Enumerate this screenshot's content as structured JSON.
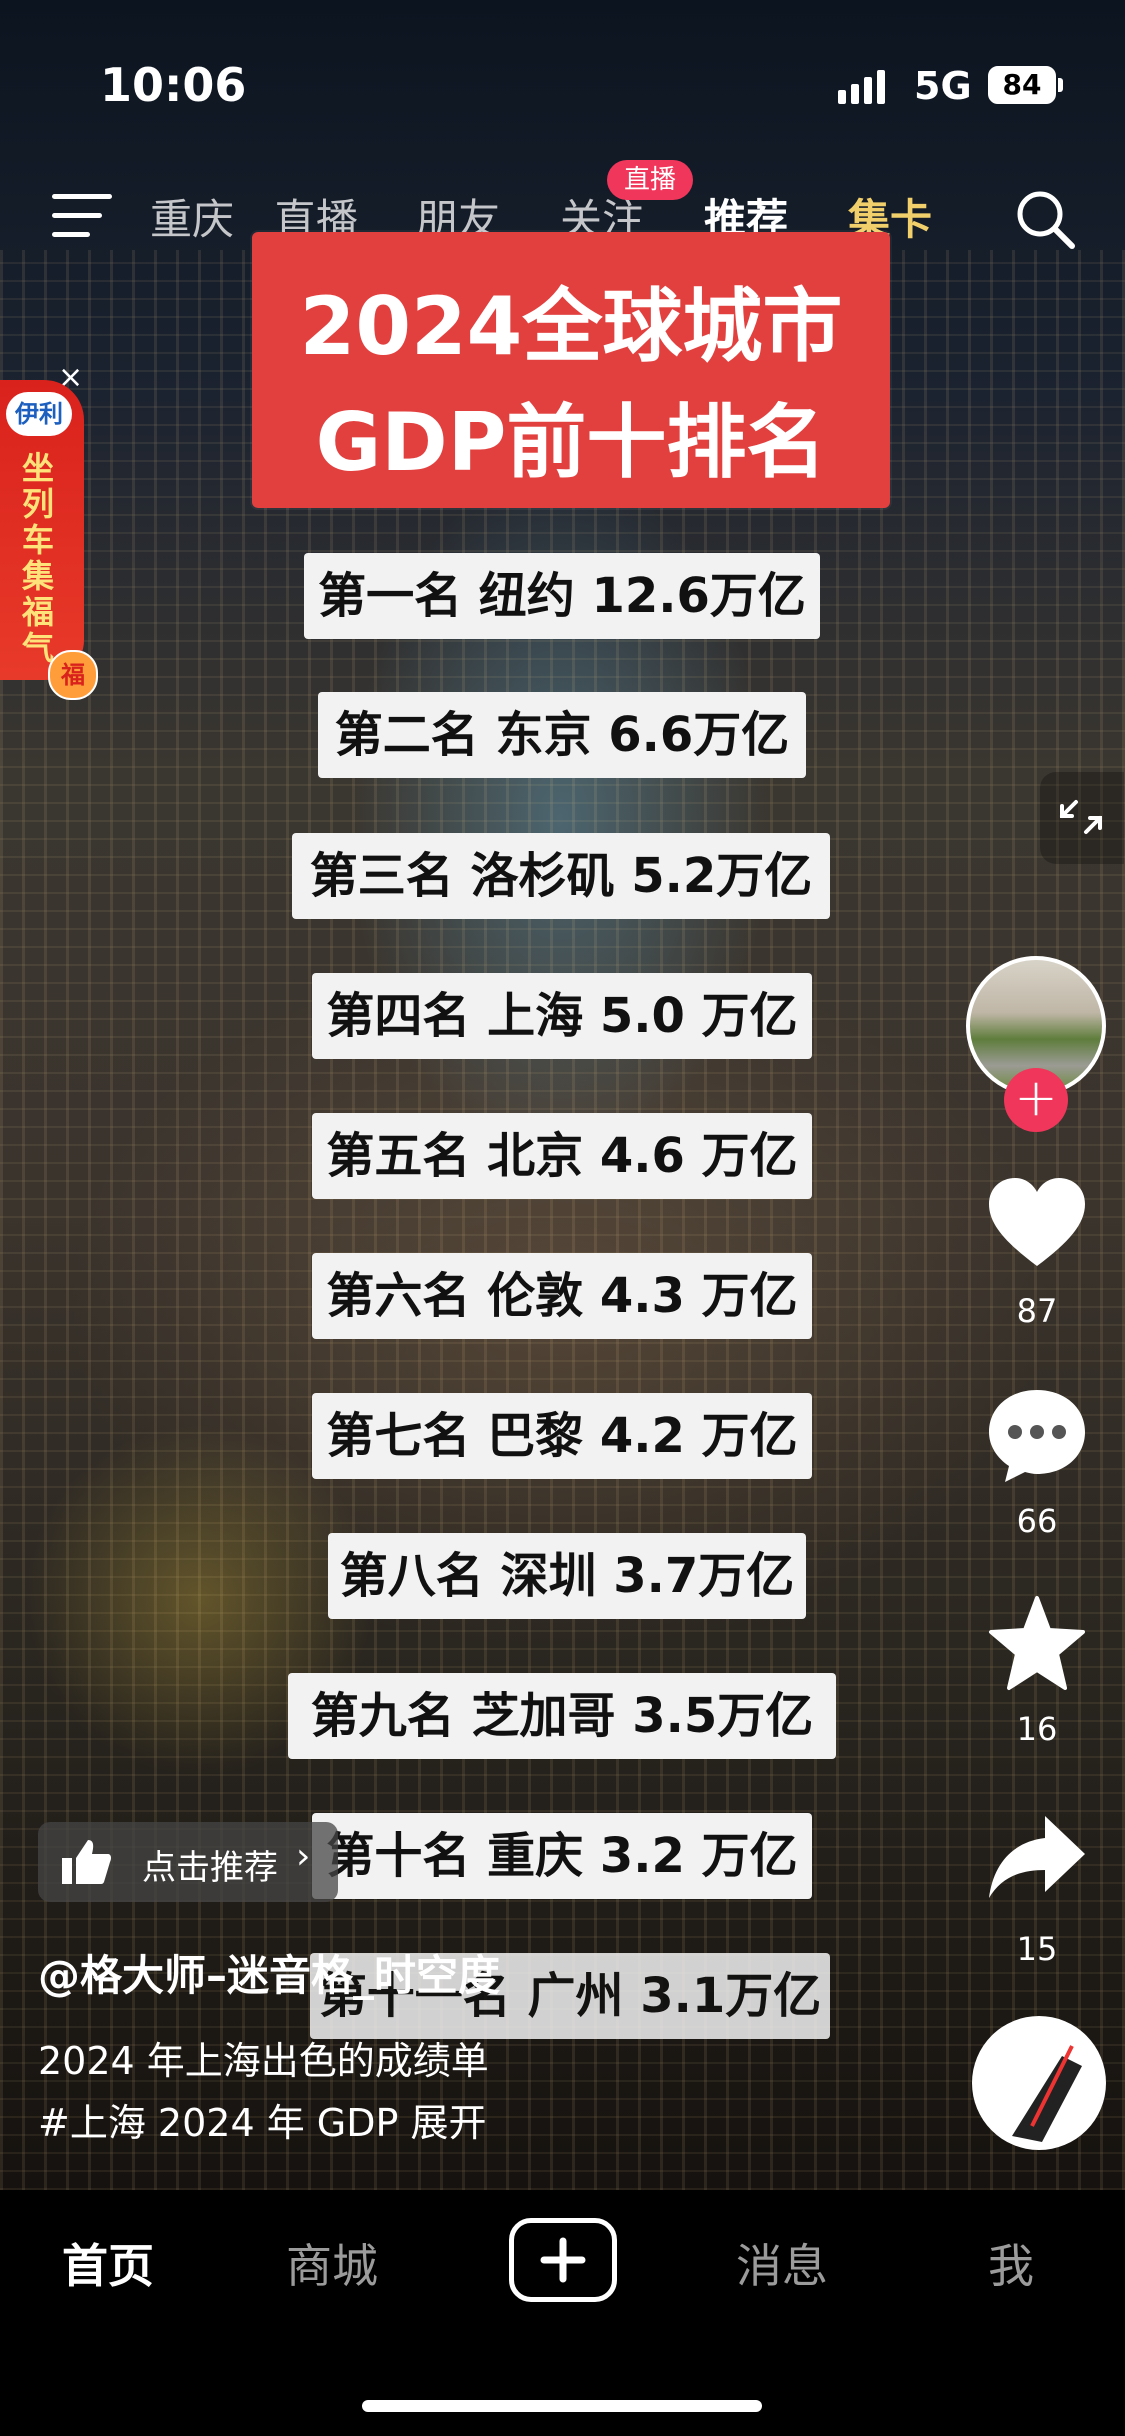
{
  "status_bar": {
    "time": "10:06",
    "network": "5G",
    "battery": "84"
  },
  "top_tabs": [
    {
      "label": "重庆"
    },
    {
      "label": "直播"
    },
    {
      "label": "朋友"
    },
    {
      "label": "关注",
      "badge": "直播"
    },
    {
      "label": "推荐",
      "active": true
    },
    {
      "label": "集卡",
      "highlight": true
    }
  ],
  "video": {
    "title_lines": [
      "2024全球城市",
      "GDP前十排名"
    ],
    "rankings": [
      "第一名 纽约 12.6万亿",
      "第二名 东京 6.6万亿",
      "第三名 洛杉矶 5.2万亿",
      "第四名 上海 5.0 万亿",
      "第五名 北京 4.6 万亿",
      "第六名 伦敦 4.3 万亿",
      "第七名 巴黎 4.2 万亿",
      "第八名 深圳 3.7万亿",
      "第九名  芝加哥 3.5万亿",
      "第十名 重庆 3.2 万亿",
      "第十一名 广州 3.1万亿"
    ]
  },
  "ad": {
    "logo": "伊利",
    "text": "坐列车集福气",
    "badge": "福",
    "close": "×"
  },
  "sidebar": {
    "likes": "87",
    "comments": "66",
    "favorites": "16",
    "shares": "15",
    "follow": "+"
  },
  "recommend": {
    "label": "点击推荐",
    "arrow": "›"
  },
  "post": {
    "author": "@格大师–迷音格_时空度",
    "caption": "2024 年上海出色的成绩单",
    "hashtag": "#上海 2024 年 GDP  展开"
  },
  "bottom_nav": [
    {
      "label": "首页",
      "active": true
    },
    {
      "label": "商城"
    },
    {
      "label": "消息"
    },
    {
      "label": "我"
    }
  ],
  "colors": {
    "accent": "#f0365a",
    "title_card": "#e2403f",
    "gold": "#f1cf6a"
  }
}
